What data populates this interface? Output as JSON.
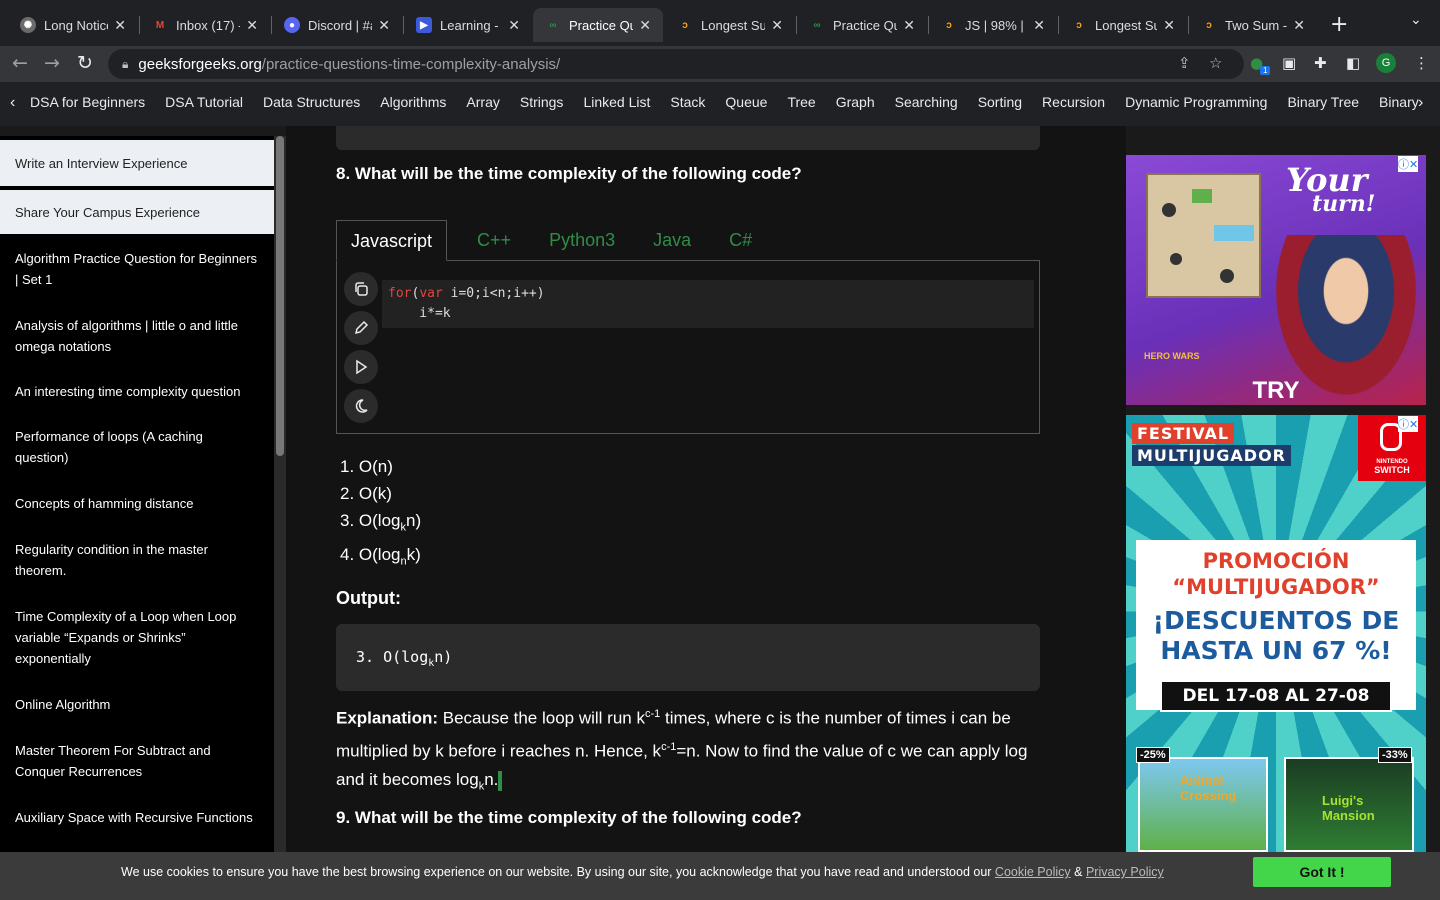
{
  "tabs": [
    {
      "title": "Long Notice",
      "icon": "chatgpt-icon"
    },
    {
      "title": "Inbox (17) -",
      "icon": "gmail-icon"
    },
    {
      "title": "Discord | #a",
      "icon": "discord-icon"
    },
    {
      "title": "Learning - I",
      "icon": "learning-icon"
    },
    {
      "title": "Practice Qu",
      "icon": "gfg-icon",
      "active": true
    },
    {
      "title": "Longest Sul",
      "icon": "leetcode-icon"
    },
    {
      "title": "Practice Qu",
      "icon": "gfg-icon"
    },
    {
      "title": "JS | 98% | S",
      "icon": "leetcode-icon"
    },
    {
      "title": "Longest Sul",
      "icon": "leetcode-icon"
    },
    {
      "title": "Two Sum -",
      "icon": "leetcode-icon"
    }
  ],
  "url": {
    "domain": "geeksforgeeks.org",
    "path": "/practice-questions-time-complexity-analysis/"
  },
  "extension_badge": "1",
  "profile_initial": "G",
  "catnav": [
    "DSA for Beginners",
    "DSA Tutorial",
    "Data Structures",
    "Algorithms",
    "Array",
    "Strings",
    "Linked List",
    "Stack",
    "Queue",
    "Tree",
    "Graph",
    "Searching",
    "Sorting",
    "Recursion",
    "Dynamic Programming",
    "Binary Tree",
    "Binary Sear"
  ],
  "sidebar": [
    "Write an Interview Experience",
    "Share Your Campus Experience",
    "Algorithm Practice Question for Beginners | Set 1",
    "Analysis of algorithms | little o and little omega notations",
    "An interesting time complexity question",
    "Performance of loops (A caching question)",
    "Concepts of hamming distance",
    "Regularity condition in the master theorem.",
    "Time Complexity of a Loop when Loop variable “Expands or Shrinks” exponentially",
    "Online Algorithm",
    "Master Theorem For Subtract and Conquer Recurrences",
    "Auxiliary Space with Recursive Functions"
  ],
  "question8": "8. What will be the time complexity of the following code?",
  "code_tabs": [
    "Javascript",
    "C++",
    "Python3",
    "Java",
    "C#"
  ],
  "code": {
    "kw_for": "for",
    "kw_var": "var",
    "line1_rest": " i=0;i<n;i++)",
    "line2": "    i*=k"
  },
  "options": [
    {
      "num": "1.",
      "text": "O(n)"
    },
    {
      "num": "2.",
      "text": "O(k)"
    },
    {
      "num": "3.",
      "text": "O(log",
      "sub": "k",
      "tail": "n)"
    },
    {
      "num": "4.",
      "text": "O(log",
      "sub": "n",
      "tail": "k)"
    }
  ],
  "output_label": "Output:",
  "output": {
    "text": "3. O(log",
    "sub": "k",
    "tail": "n)"
  },
  "explanation": {
    "label": "Explanation:",
    "p1": " Because the loop will run k",
    "sup1": "c-1",
    "p2": " times, where c is the number of times i can be multiplied by k before i reaches n. Hence, k",
    "sup2": "c-1",
    "p3": "=n. Now to find the value of c we can apply log and it becomes log",
    "sub": "k",
    "p4": "n."
  },
  "question9": "9. What will be the time complexity of the following code?",
  "ad1": {
    "line1": "Your",
    "line2": "turn!",
    "cta": "TRY",
    "logo": "HERO WARS"
  },
  "ad2": {
    "badge1": "FESTIVAL",
    "badge2": "MULTIJUGADOR",
    "brand_top": "NINTENDO",
    "brand": "SWITCH",
    "promo": "PROMOCIÓN “MULTIJUGADOR”",
    "discount": "¡DESCUENTOS DE HASTA UN 67 %!",
    "dates": "DEL 17-08 AL 27-08",
    "disc1": "-25%",
    "disc2": "-33%",
    "game1": "Animal Crossing",
    "game2": "Luigi's Mansion"
  },
  "cookie": {
    "text": "We use cookies to ensure you have the best browsing experience on our website. By using our site, you acknowledge that you have read and understood our ",
    "link1": "Cookie Policy",
    "amp": " & ",
    "link2": "Privacy Policy",
    "button": "Got It !"
  }
}
